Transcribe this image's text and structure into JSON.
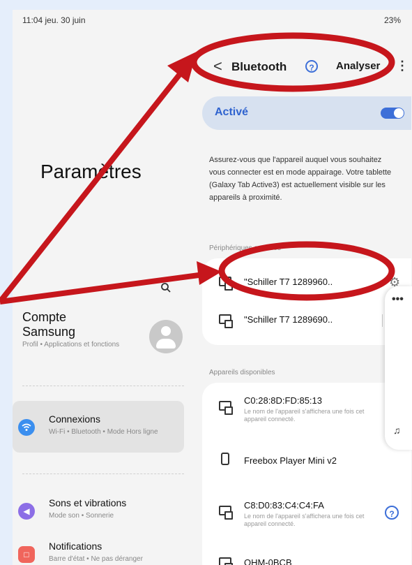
{
  "status_bar": {
    "time_date": "11:04 jeu. 30 juin",
    "right": "23%"
  },
  "left_panel": {
    "title": "Paramètres",
    "account": {
      "name": "Compte Samsung",
      "sub": "Profil • Applications et fonctions"
    },
    "items": [
      {
        "title": "Connexions",
        "sub": "Wi-Fi • Bluetooth • Mode Hors ligne",
        "icon": "wifi-icon",
        "color": "#3b8fef",
        "selected": true
      },
      {
        "title": "Sons et vibrations",
        "sub": "Mode son • Sonnerie",
        "icon": "volume-icon",
        "color": "#8c6ee6",
        "selected": false
      },
      {
        "title": "Notifications",
        "sub": "Barre d'état • Ne pas déranger",
        "icon": "notification-icon",
        "color": "#f0655c",
        "selected": false
      }
    ]
  },
  "header": {
    "back": "<",
    "title": "Bluetooth",
    "help": "?",
    "scan": "Analyser",
    "more": "⋮"
  },
  "toggle": {
    "label": "Activé",
    "on": true
  },
  "description": "Assurez-vous que l'appareil auquel vous souhaitez vous connecter est en mode appairage. Votre tablette (Galaxy Tab Active3) est actuellement visible sur les appareils à proximité.",
  "paired": {
    "header": "Périphériques appairés",
    "devices": [
      {
        "name": "\"Schiller T7 1289960.."
      },
      {
        "name": "\"Schiller T7 1289690.."
      }
    ]
  },
  "available": {
    "header": "Appareils disponibles",
    "devices": [
      {
        "name": "C0:28:8D:FD:85:13",
        "note": "Le nom de l'appareil s'affichera une fois cet appareil connecté."
      },
      {
        "name": "Freebox Player Mini v2",
        "note": ""
      },
      {
        "name": "C8:D0:83:C4:C4:FA",
        "note": "Le nom de l'appareil s'affichera une fois cet appareil connecté."
      },
      {
        "name": "QHM-0BCB",
        "note": ""
      }
    ]
  },
  "annotation_color": "#c6161c"
}
